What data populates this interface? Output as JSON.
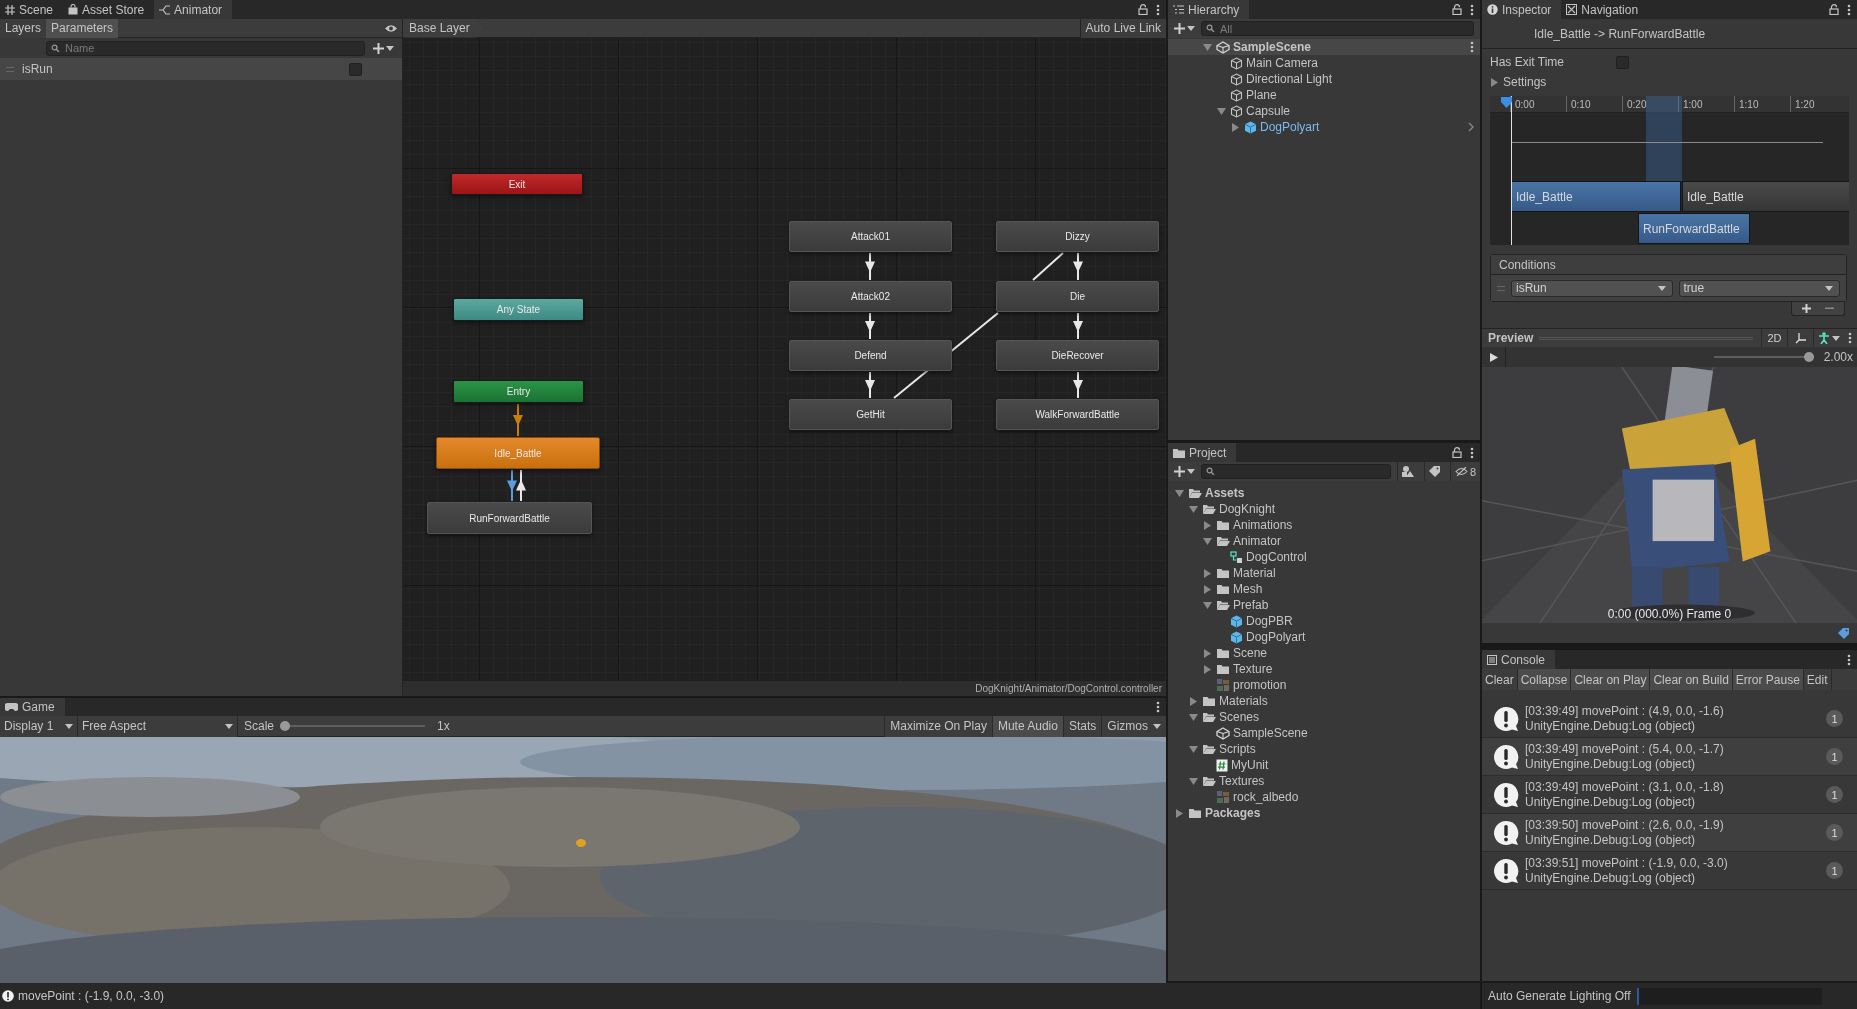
{
  "window_tabs": [
    {
      "label": "Scene",
      "kind": "scene",
      "selected": false
    },
    {
      "label": "Asset Store",
      "kind": "store",
      "selected": false
    },
    {
      "label": "Animator",
      "kind": "animator",
      "selected": true
    }
  ],
  "animator": {
    "panel_tabs": [
      {
        "label": "Layers",
        "selected": false
      },
      {
        "label": "Parameters",
        "selected": true
      }
    ],
    "search": {
      "placeholder": "Name"
    },
    "parameters": [
      {
        "name": "isRun",
        "checked": false
      }
    ],
    "breadcrumb": "Base Layer",
    "live_link": "Auto Live Link",
    "states": [
      {
        "label": "Exit",
        "kind": "exit"
      },
      {
        "label": "Any State",
        "kind": "any"
      },
      {
        "label": "Entry",
        "kind": "entry"
      },
      {
        "label": "Idle_Battle",
        "kind": "default"
      },
      {
        "label": "RunForwardBattle",
        "kind": "state"
      },
      {
        "label": "Attack01",
        "kind": "state"
      },
      {
        "label": "Attack02",
        "kind": "state"
      },
      {
        "label": "Defend",
        "kind": "state"
      },
      {
        "label": "GetHit",
        "kind": "state"
      },
      {
        "label": "Dizzy",
        "kind": "state"
      },
      {
        "label": "Die",
        "kind": "state"
      },
      {
        "label": "DieRecover",
        "kind": "state"
      },
      {
        "label": "WalkForwardBattle",
        "kind": "state"
      }
    ],
    "path": "DogKnight/Animator/DogControl.controller"
  },
  "game": {
    "tab": "Game",
    "display": "Display 1",
    "aspect": "Free Aspect",
    "scale": {
      "label": "Scale",
      "level": 0,
      "reading": "1x"
    },
    "buttons": [
      {
        "label": "Maximize On Play",
        "on": false
      },
      {
        "label": "Mute Audio",
        "on": true
      },
      {
        "label": "Stats",
        "on": false
      },
      {
        "label": "Gizmos",
        "on": false
      }
    ]
  },
  "hierarchy": {
    "title": "Hierarchy",
    "search": {
      "placeholder": "All"
    },
    "tree": [
      {
        "label": "SampleScene",
        "kind": "scene",
        "expanded": true,
        "children": [
          {
            "label": "Main Camera",
            "kind": "object"
          },
          {
            "label": "Directional Light",
            "kind": "object"
          },
          {
            "label": "Plane",
            "kind": "object"
          },
          {
            "label": "Capsule",
            "kind": "object",
            "expanded": true,
            "children": [
              {
                "label": "DogPolyart",
                "kind": "prefab",
                "expanded": false
              }
            ]
          }
        ]
      }
    ]
  },
  "project": {
    "title": "Project",
    "hidden_count": "8",
    "tree": [
      {
        "label": "Assets",
        "kind": "folder",
        "expanded": true,
        "children": [
          {
            "label": "DogKnight",
            "kind": "folder",
            "expanded": true,
            "children": [
              {
                "label": "Animations",
                "kind": "folder",
                "expanded": false
              },
              {
                "label": "Animator",
                "kind": "folder",
                "expanded": true,
                "children": [
                  {
                    "label": "DogControl",
                    "kind": "controller"
                  }
                ]
              },
              {
                "label": "Material",
                "kind": "folder",
                "expanded": false
              },
              {
                "label": "Mesh",
                "kind": "folder",
                "expanded": false
              },
              {
                "label": "Prefab",
                "kind": "folder",
                "expanded": true,
                "children": [
                  {
                    "label": "DogPBR",
                    "kind": "prefab"
                  },
                  {
                    "label": "DogPolyart",
                    "kind": "prefab"
                  }
                ]
              },
              {
                "label": "Scene",
                "kind": "folder",
                "expanded": false
              },
              {
                "label": "Texture",
                "kind": "folder",
                "expanded": false
              },
              {
                "label": "promotion"
              }
            ]
          },
          {
            "label": "Materials",
            "kind": "folder",
            "expanded": false
          },
          {
            "label": "Scenes",
            "kind": "folder",
            "expanded": true,
            "children": [
              {
                "label": "SampleScene",
                "kind": "scene"
              }
            ]
          },
          {
            "label": "Scripts",
            "kind": "folder",
            "expanded": true,
            "children": [
              {
                "label": "MyUnit",
                "kind": "script"
              }
            ]
          },
          {
            "label": "Textures",
            "kind": "folder",
            "expanded": true,
            "children": [
              {
                "label": "rock_albedo"
              }
            ]
          }
        ]
      },
      {
        "label": "Packages",
        "kind": "folder",
        "expanded": false
      }
    ]
  },
  "inspector": {
    "tabs": [
      {
        "label": "Inspector",
        "kind": "info",
        "selected": true
      },
      {
        "label": "Navigation",
        "kind": "navigation",
        "selected": false
      }
    ],
    "title": "Idle_Battle -> RunForwardBattle",
    "has_exit_time": {
      "label": "Has Exit Time",
      "checked": false
    },
    "settings": {
      "label": "Settings",
      "expanded": false
    },
    "timeline": {
      "ticks": [
        "0:00",
        "0:10",
        "0:20",
        "1:00",
        "1:10",
        "1:20"
      ],
      "source_clips": [
        "Idle_Battle",
        "Idle_Battle"
      ],
      "target_clip": "RunForwardBattle"
    },
    "conditions": {
      "title": "Conditions",
      "rows": [
        {
          "parameter": "isRun",
          "value": "true"
        }
      ]
    },
    "preview": {
      "title": "Preview",
      "mode": "2D",
      "speed": {
        "level": 1,
        "reading": "2.00x"
      },
      "frame": "0:00 (000.0%) Frame 0"
    }
  },
  "console": {
    "title": "Console",
    "buttons": [
      {
        "label": "Clear",
        "on": false
      },
      {
        "label": "Collapse",
        "on": true
      },
      {
        "label": "Clear on Play",
        "on": true
      },
      {
        "label": "Clear on Build",
        "on": true
      },
      {
        "label": "Error Pause",
        "on": true
      },
      {
        "label": "Edit",
        "on": false
      }
    ],
    "entries": [
      {
        "message": "[03:39:49] movePoint : (4.9, 0.0, -1.6)",
        "trace": "UnityEngine.Debug:Log (object)",
        "count": "1"
      },
      {
        "message": "[03:39:49] movePoint : (5.4, 0.0, -1.7)",
        "trace": "UnityEngine.Debug:Log (object)",
        "count": "1"
      },
      {
        "message": "[03:39:49] movePoint : (3.1, 0.0, -1.8)",
        "trace": "UnityEngine.Debug:Log (object)",
        "count": "1"
      },
      {
        "message": "[03:39:50] movePoint : (2.6, 0.0, -1.9)",
        "trace": "UnityEngine.Debug:Log (object)",
        "count": "1"
      },
      {
        "message": "[03:39:51] movePoint : (-1.9, 0.0, -3.0)",
        "trace": "UnityEngine.Debug:Log (object)",
        "count": "1"
      }
    ]
  },
  "status_bar": {
    "message": "movePoint : (-1.9, 0.0, -3.0)",
    "lighting": "Auto Generate Lighting Off"
  }
}
